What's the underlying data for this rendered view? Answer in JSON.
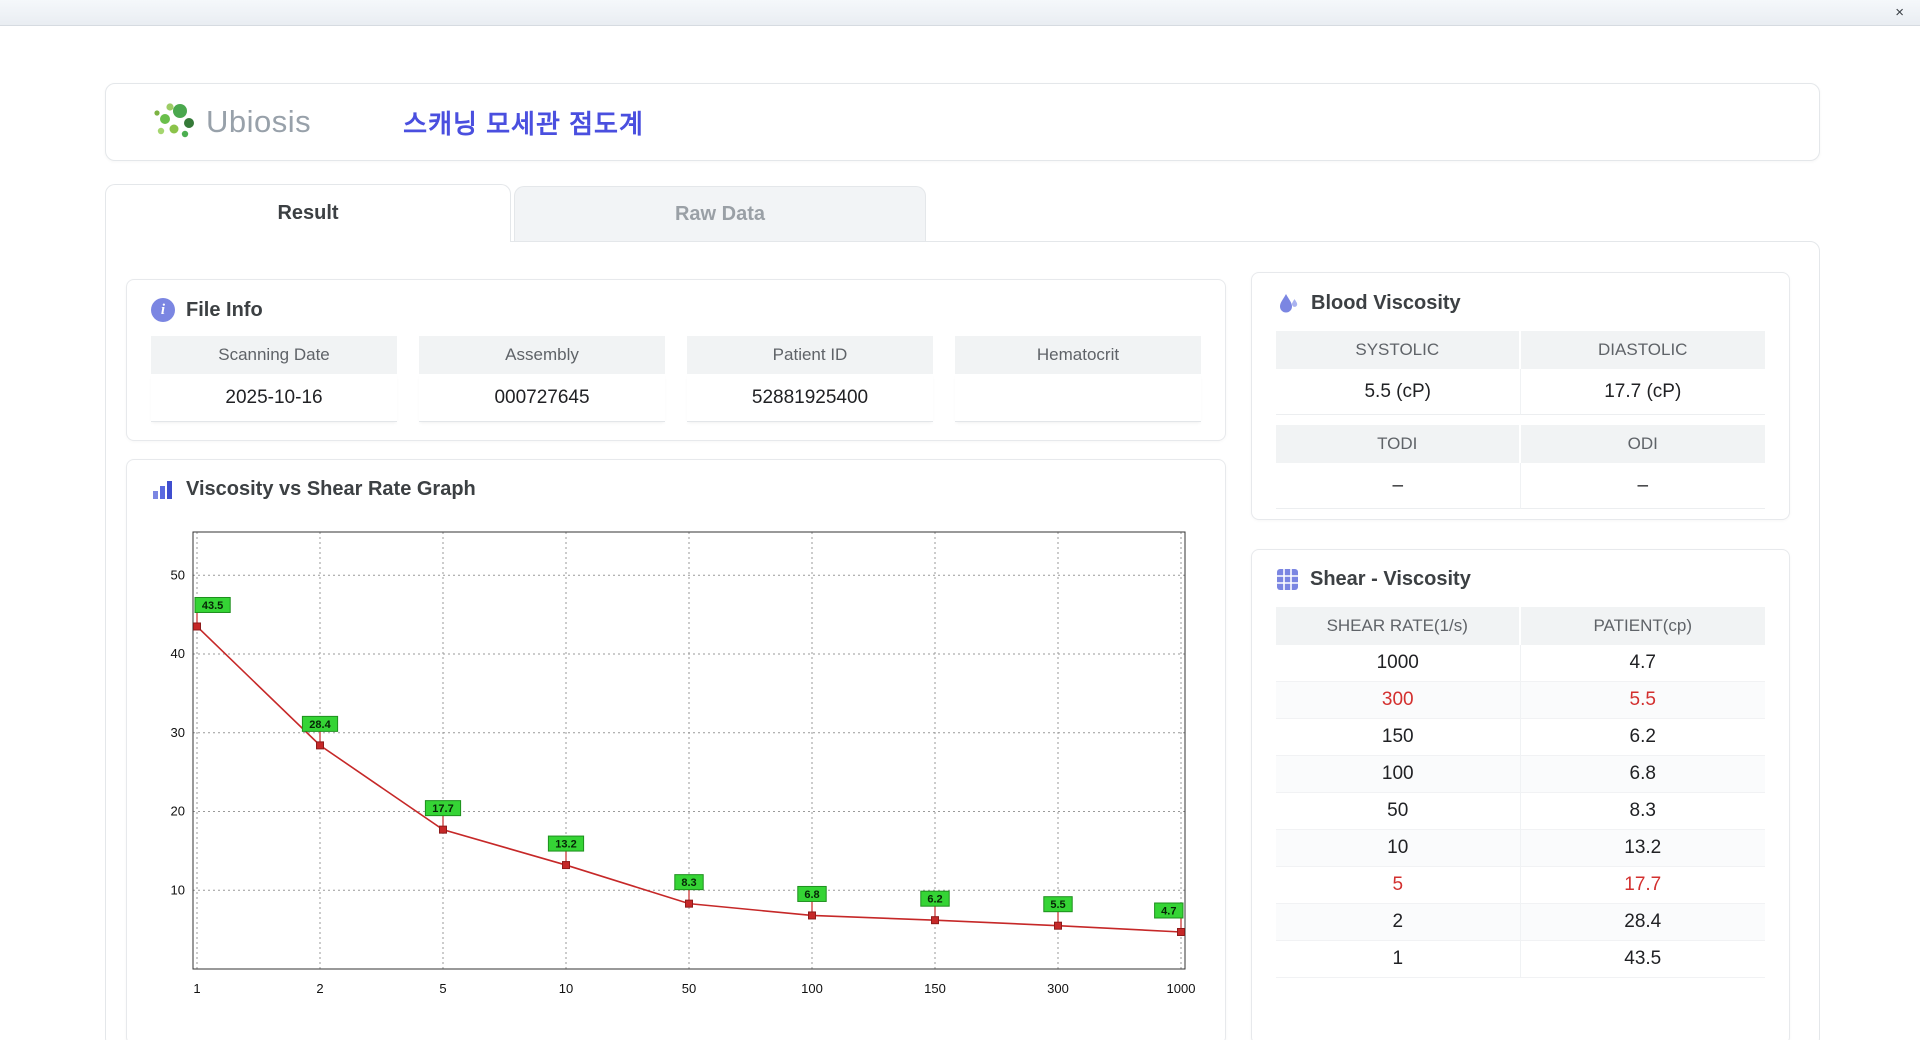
{
  "window": {
    "close_label": "×"
  },
  "header": {
    "logo_text": "Ubiosis",
    "title": "스캐닝 모세관 점도계"
  },
  "tabs": [
    {
      "label": "Result",
      "active": true
    },
    {
      "label": "Raw Data",
      "active": false
    }
  ],
  "file_info": {
    "title": "File Info",
    "fields": [
      {
        "label": "Scanning Date",
        "value": "2025-10-16"
      },
      {
        "label": "Assembly",
        "value": "000727645"
      },
      {
        "label": "Patient ID",
        "value": "52881925400"
      },
      {
        "label": "Hematocrit",
        "value": ""
      }
    ]
  },
  "graph": {
    "title": "Viscosity vs Shear Rate Graph"
  },
  "chart_data": {
    "type": "line",
    "title": "Viscosity vs Shear Rate Graph",
    "x_labels": [
      "1",
      "2",
      "5",
      "10",
      "50",
      "100",
      "150",
      "300",
      "1000"
    ],
    "x_scale": "categorical",
    "values": [
      43.5,
      28.4,
      17.7,
      13.2,
      8.3,
      6.8,
      6.2,
      5.5,
      4.7
    ],
    "point_labels": [
      "43.5",
      "28.4",
      "17.7",
      "13.2",
      "8.3",
      "6.8",
      "6.2",
      "5.5",
      "4.7"
    ],
    "yticks": [
      10,
      20,
      30,
      40,
      50
    ],
    "ylim": [
      0,
      55.5
    ],
    "xlabel": "",
    "ylabel": "",
    "grid": true,
    "legend": "none",
    "line_color": "#c62828",
    "marker_color": "#c62828",
    "label_bg": "#35d435",
    "label_border": "#1d8f1d"
  },
  "blood_viscosity": {
    "title": "Blood Viscosity",
    "row1": {
      "headers": [
        "SYSTOLIC",
        "DIASTOLIC"
      ],
      "values": [
        "5.5 (cP)",
        "17.7 (cP)"
      ]
    },
    "row2": {
      "headers": [
        "TODI",
        "ODI"
      ],
      "values": [
        "–",
        "–"
      ]
    }
  },
  "shear_viscosity": {
    "title": "Shear - Viscosity",
    "columns": [
      "SHEAR RATE(1/s)",
      "PATIENT(cp)"
    ],
    "rows": [
      {
        "shear": "1000",
        "patient": "4.7",
        "highlight": false
      },
      {
        "shear": "300",
        "patient": "5.5",
        "highlight": true
      },
      {
        "shear": "150",
        "patient": "6.2",
        "highlight": false
      },
      {
        "shear": "100",
        "patient": "6.8",
        "highlight": false
      },
      {
        "shear": "50",
        "patient": "8.3",
        "highlight": false
      },
      {
        "shear": "10",
        "patient": "13.2",
        "highlight": false
      },
      {
        "shear": "5",
        "patient": "17.7",
        "highlight": true
      },
      {
        "shear": "2",
        "patient": "28.4",
        "highlight": false
      },
      {
        "shear": "1",
        "patient": "43.5",
        "highlight": false
      }
    ]
  },
  "colors": {
    "accent_blue": "#4a4fdf",
    "icon_blue": "#7b86e2",
    "highlight_red": "#d3302f",
    "label_green": "#35d435",
    "header_gray": "#f1f3f4"
  }
}
